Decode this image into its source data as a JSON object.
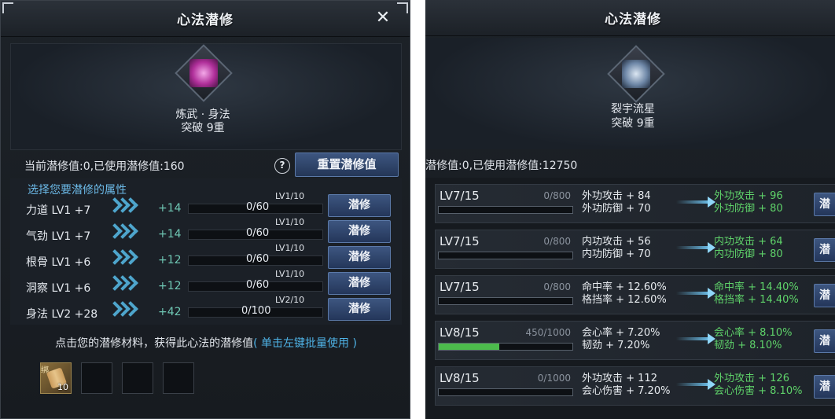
{
  "left": {
    "title": "心法潜修",
    "close": "✕",
    "skill": {
      "name": "炼武 · 身法",
      "breakthrough": "突破 9重"
    },
    "info": "当前潜修值:0,已使用潜修值:160",
    "help": "?",
    "reset_label": "重置潜修值",
    "section_label": "选择您要潜修的属性",
    "attributes": [
      {
        "name": "力道 LV1 +7",
        "plus": "+14",
        "progress": "0/60",
        "lv": "LV1/10",
        "button": "潜修"
      },
      {
        "name": "气劲 LV1 +7",
        "plus": "+14",
        "progress": "0/60",
        "lv": "LV1/10",
        "button": "潜修"
      },
      {
        "name": "根骨 LV1 +6",
        "plus": "+12",
        "progress": "0/60",
        "lv": "LV1/10",
        "button": "潜修"
      },
      {
        "name": "洞察 LV1 +6",
        "plus": "+12",
        "progress": "0/60",
        "lv": "LV1/10",
        "button": "潜修"
      },
      {
        "name": "身法 LV2 +28",
        "plus": "+42",
        "progress": "0/100",
        "lv": "LV2/10",
        "button": "潜修"
      }
    ],
    "hint": "点击您的潜修材料，获得此心法的潜修值",
    "hint_link": "( 单击左键批量使用 )",
    "slot_item": {
      "mark": "绑",
      "count": "10"
    }
  },
  "right": {
    "title": "心法潜修",
    "skill": {
      "name": "裂宇流星",
      "breakthrough": "突破 9重"
    },
    "info": "潜修值:0,已使用潜修值:12750",
    "button_label": "潜",
    "rows": [
      {
        "lv": "LV7/15",
        "progress": "0/800",
        "fill": 0.0,
        "cur": [
          "外功攻击 + 84",
          "外功防御 + 70"
        ],
        "next": [
          "外功攻击 + 96",
          "外功防御 + 80"
        ]
      },
      {
        "lv": "LV7/15",
        "progress": "0/800",
        "fill": 0.0,
        "cur": [
          "内功攻击 + 56",
          "内功防御 + 70"
        ],
        "next": [
          "内功攻击 + 64",
          "内功防御 + 80"
        ]
      },
      {
        "lv": "LV7/15",
        "progress": "0/800",
        "fill": 0.0,
        "cur": [
          "命中率 + 12.60%",
          "格挡率 + 12.60%"
        ],
        "next": [
          "命中率 + 14.40%",
          "格挡率 + 14.40%"
        ]
      },
      {
        "lv": "LV8/15",
        "progress": "450/1000",
        "fill": 0.45,
        "cur": [
          "会心率 + 7.20%",
          "韧劲 + 7.20%"
        ],
        "next": [
          "会心率 + 8.10%",
          "韧劲 + 8.10%"
        ]
      },
      {
        "lv": "LV8/15",
        "progress": "0/1000",
        "fill": 0.0,
        "cur": [
          "外功攻击 + 112",
          "会心伤害 + 7.20%"
        ],
        "next": [
          "外功攻击 + 126",
          "会心伤害 + 8.10%"
        ]
      }
    ]
  }
}
